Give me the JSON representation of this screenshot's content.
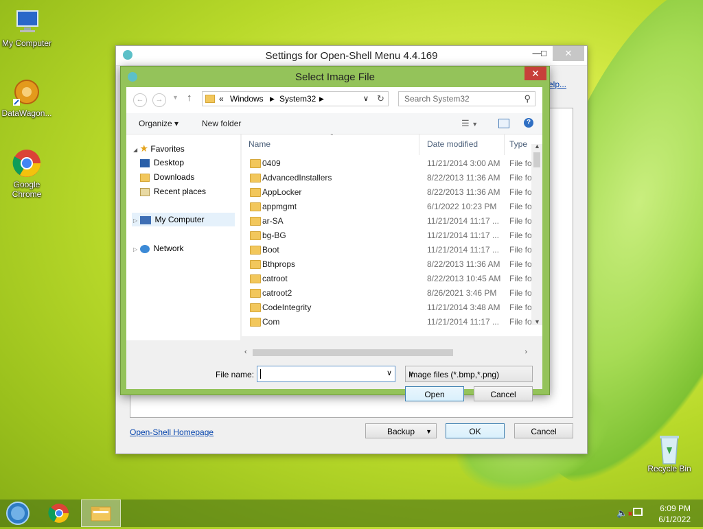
{
  "desktop": {
    "icons": [
      {
        "label": "My Computer"
      },
      {
        "label": "DataWagon..."
      },
      {
        "label": "Google Chrome"
      },
      {
        "label": "Recycle Bin"
      }
    ]
  },
  "settings_window": {
    "title": "Settings for Open-Shell Menu 4.4.169",
    "help_link": "elp...",
    "homepage_link": "Open-Shell Homepage",
    "backup_label": "Backup",
    "ok_label": "OK",
    "cancel_label": "Cancel",
    "minimize": "—",
    "maximize": "□",
    "close": "✕"
  },
  "dialog": {
    "title": "Select Image File",
    "close": "✕",
    "address": {
      "prefix": "«",
      "crumbs": [
        "Windows",
        "System32"
      ]
    },
    "search_placeholder": "Search System32",
    "toolbar": {
      "organize": "Organize ▾",
      "new_folder": "New folder"
    },
    "nav": {
      "favorites": "Favorites",
      "desktop": "Desktop",
      "downloads": "Downloads",
      "recent": "Recent places",
      "my_computer": "My Computer",
      "network": "Network"
    },
    "columns": {
      "name": "Name",
      "date": "Date modified",
      "type": "Type"
    },
    "files": [
      {
        "name": "0409",
        "date": "11/21/2014 3:00 AM",
        "type": "File fol"
      },
      {
        "name": "AdvancedInstallers",
        "date": "8/22/2013 11:36 AM",
        "type": "File fol"
      },
      {
        "name": "AppLocker",
        "date": "8/22/2013 11:36 AM",
        "type": "File fol"
      },
      {
        "name": "appmgmt",
        "date": "6/1/2022 10:23 PM",
        "type": "File fol"
      },
      {
        "name": "ar-SA",
        "date": "11/21/2014 11:17 ...",
        "type": "File fol"
      },
      {
        "name": "bg-BG",
        "date": "11/21/2014 11:17 ...",
        "type": "File fol"
      },
      {
        "name": "Boot",
        "date": "11/21/2014 11:17 ...",
        "type": "File fol"
      },
      {
        "name": "Bthprops",
        "date": "8/22/2013 11:36 AM",
        "type": "File fol"
      },
      {
        "name": "catroot",
        "date": "8/22/2013 10:45 AM",
        "type": "File fol"
      },
      {
        "name": "catroot2",
        "date": "8/26/2021 3:46 PM",
        "type": "File fol"
      },
      {
        "name": "CodeIntegrity",
        "date": "11/21/2014 3:48 AM",
        "type": "File fol"
      },
      {
        "name": "Com",
        "date": "11/21/2014 11:17 ...",
        "type": "File fol"
      }
    ],
    "file_name_label": "File name:",
    "file_name_value": "",
    "file_type": "Image files (*.bmp,*.png)",
    "open_label": "Open",
    "cancel_label": "Cancel"
  },
  "taskbar": {
    "time": "6:09 PM",
    "date": "6/1/2022"
  }
}
